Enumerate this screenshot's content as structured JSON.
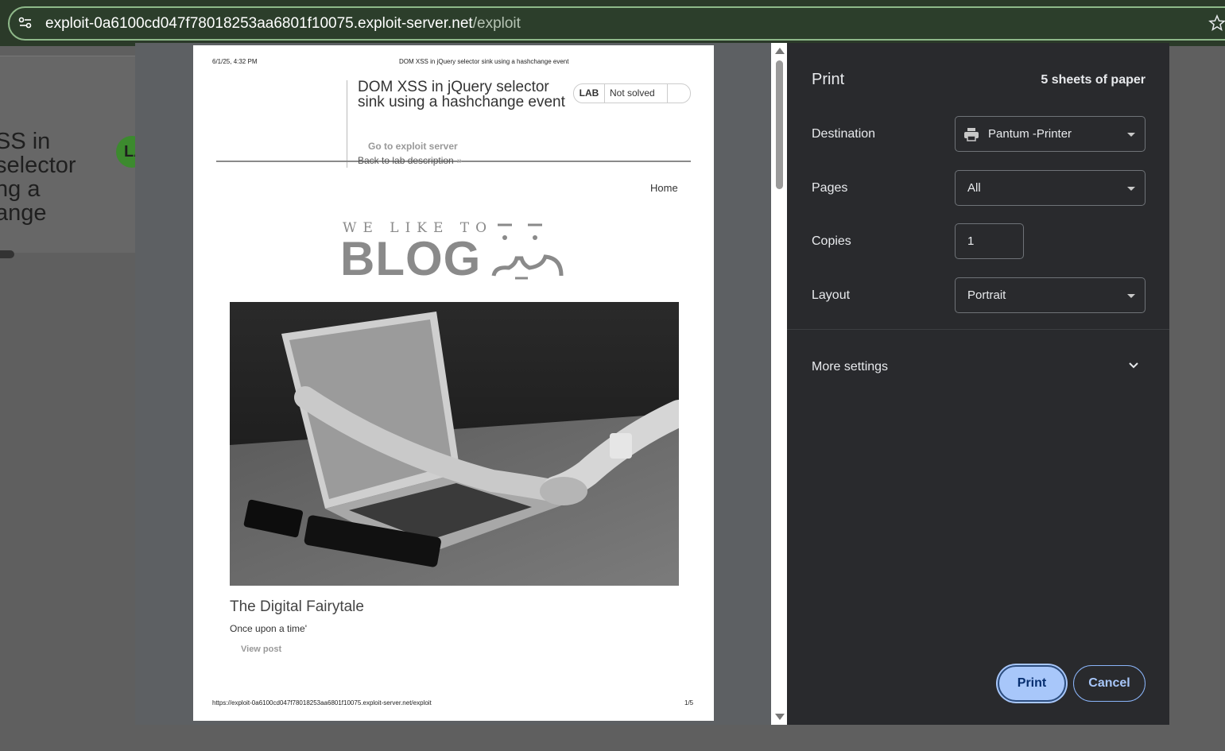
{
  "browser": {
    "url_host": "exploit-0a6100cd047f78018253aa6801f10075.exploit-server.net",
    "url_path": "/exploit"
  },
  "background_page": {
    "title_fragment": "SS in\nselector\nng a\nange",
    "badge_fragment": "LA"
  },
  "preview": {
    "header_date": "6/1/25, 4:32 PM",
    "header_title": "DOM XSS in jQuery selector sink using a hashchange event",
    "lab_title": "DOM XSS in jQuery selector sink using a hashchange event",
    "lab_tag": "LAB",
    "lab_status": "Not solved",
    "exploit_link": "Go to exploit server",
    "back_link": "Back to lab description",
    "back_chevron": "»",
    "home_link": "Home",
    "logo_small": "WE LIKE TO",
    "logo_big": "BLOG",
    "post_title": "The Digital Fairytale",
    "post_desc": "Once upon a time'",
    "post_view": "View post",
    "footer_url": "https://exploit-0a6100cd047f78018253aa6801f10075.exploit-server.net/exploit",
    "footer_page": "1/5"
  },
  "print_panel": {
    "title": "Print",
    "sheets": "5 sheets of paper",
    "destination_label": "Destination",
    "destination_value": "Pantum -Printer",
    "pages_label": "Pages",
    "pages_value": "All",
    "copies_label": "Copies",
    "copies_value": "1",
    "layout_label": "Layout",
    "layout_value": "Portrait",
    "more_settings": "More settings",
    "print_button": "Print",
    "cancel_button": "Cancel"
  },
  "colors": {
    "accent": "#a8c7fa",
    "panel_bg": "#292a2d",
    "omnibox_border": "#8fb98a"
  }
}
